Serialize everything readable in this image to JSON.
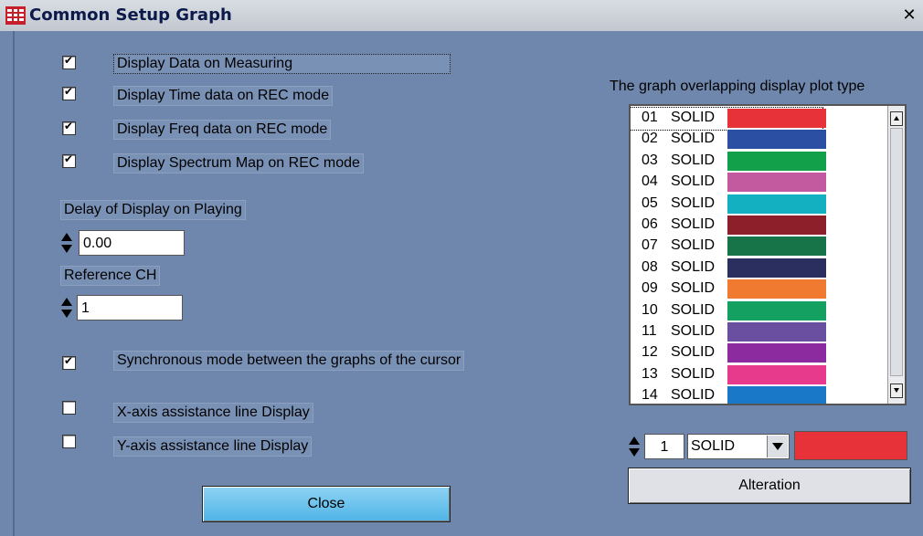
{
  "window": {
    "title": "Common Setup Graph",
    "close_glyph": "✕"
  },
  "checkboxes": [
    {
      "label": "Display Data on Measuring",
      "checked": true
    },
    {
      "label": "Display Time data on REC mode",
      "checked": true
    },
    {
      "label": "Display Freq data on REC mode",
      "checked": true
    },
    {
      "label": "Display Spectrum Map on REC mode",
      "checked": true
    },
    {
      "label": "Synchronous mode between the graphs of the cursor",
      "checked": true
    },
    {
      "label": "X-axis assistance line Display",
      "checked": false
    },
    {
      "label": "Y-axis assistance line Display",
      "checked": false
    }
  ],
  "delay": {
    "label": "Delay of Display on Playing",
    "value": "0.00"
  },
  "reference": {
    "label": "Reference CH",
    "value": "1"
  },
  "close_button": "Close",
  "plot_type": {
    "title": "The graph overlapping display plot type",
    "items": [
      {
        "num": "01",
        "style": "SOLID",
        "color": "#e8323a"
      },
      {
        "num": "02",
        "style": "SOLID",
        "color": "#2b4fa3"
      },
      {
        "num": "03",
        "style": "SOLID",
        "color": "#12a04a"
      },
      {
        "num": "04",
        "style": "SOLID",
        "color": "#c35aa0"
      },
      {
        "num": "05",
        "style": "SOLID",
        "color": "#12b0c0"
      },
      {
        "num": "06",
        "style": "SOLID",
        "color": "#8c1f2a"
      },
      {
        "num": "07",
        "style": "SOLID",
        "color": "#167448"
      },
      {
        "num": "08",
        "style": "SOLID",
        "color": "#2a2f60"
      },
      {
        "num": "09",
        "style": "SOLID",
        "color": "#f07a30"
      },
      {
        "num": "10",
        "style": "SOLID",
        "color": "#14a060"
      },
      {
        "num": "11",
        "style": "SOLID",
        "color": "#6a4fa0"
      },
      {
        "num": "12",
        "style": "SOLID",
        "color": "#8c2aa0"
      },
      {
        "num": "13",
        "style": "SOLID",
        "color": "#e83a8c"
      },
      {
        "num": "14",
        "style": "SOLID",
        "color": "#1a78c8"
      }
    ],
    "edit_index": "1",
    "edit_style": "SOLID",
    "edit_color": "#e8323a",
    "alteration_button": "Alteration"
  }
}
